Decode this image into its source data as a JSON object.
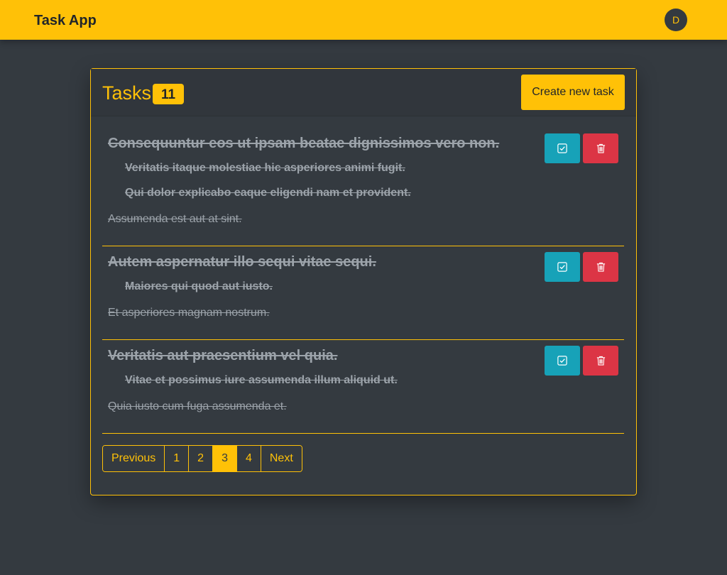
{
  "app": {
    "brand": "Task App",
    "avatar_initial": "D"
  },
  "header": {
    "title": "Tasks",
    "count": "11",
    "create_label": "Create new task"
  },
  "tasks": [
    {
      "title": "Consequuntur eos ut ipsam beatae dignissimos vero non.",
      "subtasks": [
        "Veritatis itaque molestiae hic asperiores animi fugit.",
        "Qui dolor explicabo eaque eligendi nam et provident."
      ],
      "description": "Assumenda est aut at sint.",
      "completed": true
    },
    {
      "title": "Autem aspernatur illo sequi vitae sequi.",
      "subtasks": [
        "Maiores qui quod aut iusto."
      ],
      "description": "Et asperiores magnam nostrum.",
      "completed": true
    },
    {
      "title": "Veritatis aut praesentium vel quia.",
      "subtasks": [
        "Vitae et possimus iure assumenda illum aliquid ut."
      ],
      "description": "Quia iusto cum fuga assumenda et.",
      "completed": true
    }
  ],
  "pagination": {
    "previous": "Previous",
    "pages": [
      "1",
      "2",
      "3",
      "4"
    ],
    "active": "3",
    "next": "Next"
  },
  "colors": {
    "accent": "#ffc107",
    "background": "#343a40",
    "complete": "#17a2b8",
    "delete": "#dc3545"
  },
  "icons": {
    "complete": "check-square-icon",
    "delete": "trash-icon"
  }
}
